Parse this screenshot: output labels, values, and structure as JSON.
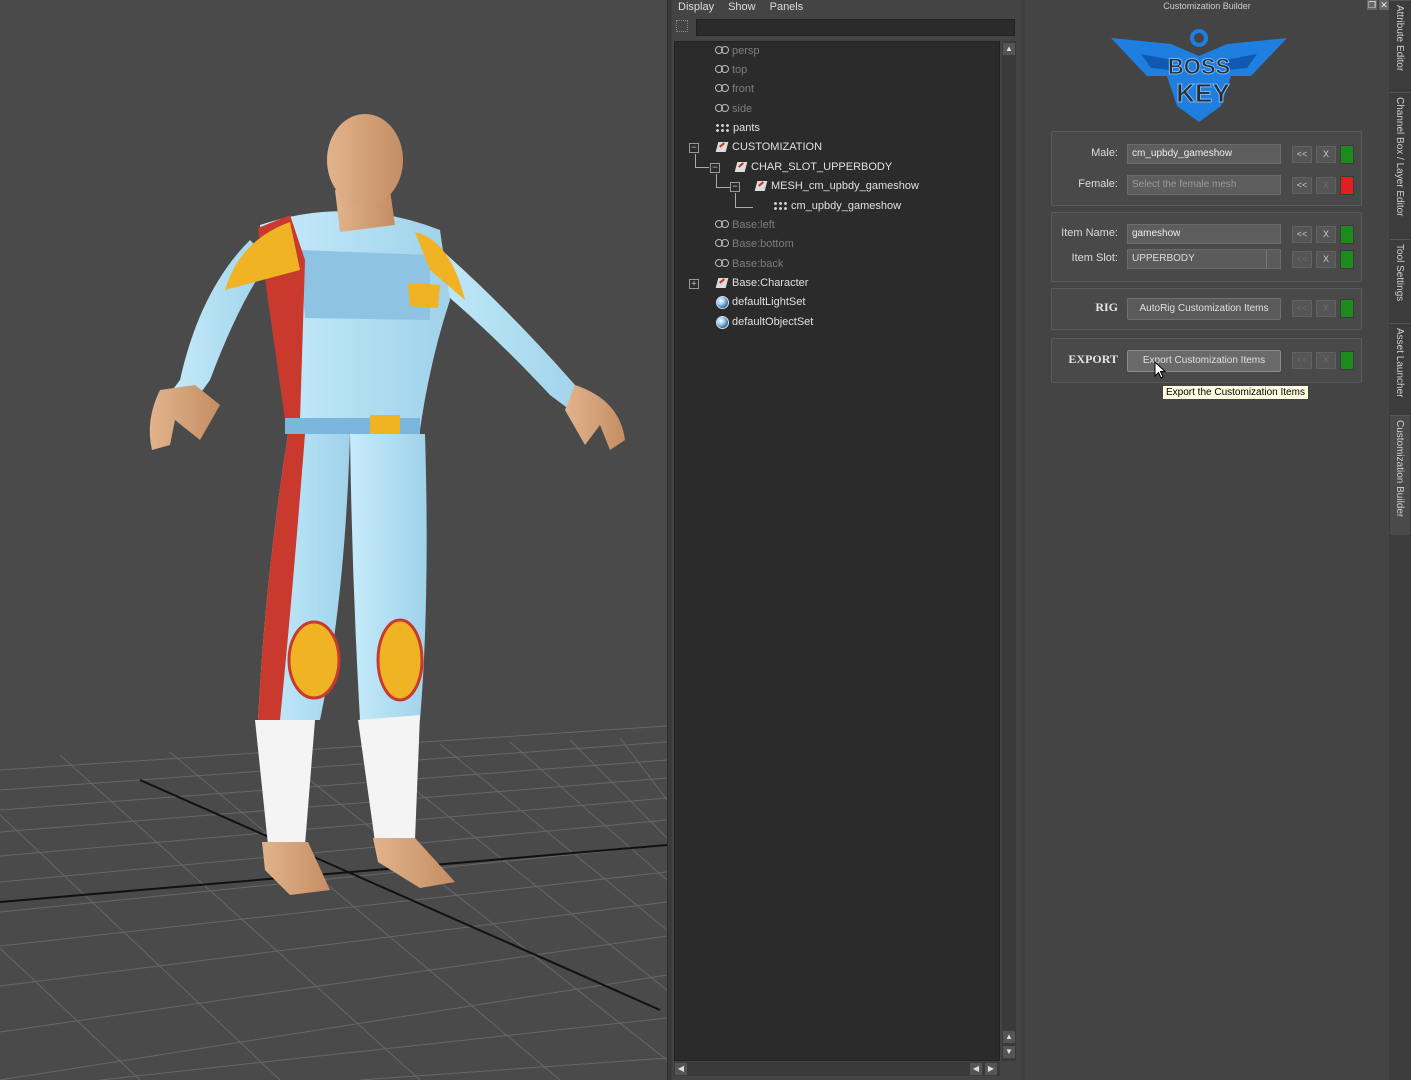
{
  "outliner": {
    "menus": [
      "Display",
      "Show",
      "Panels"
    ],
    "filter_value": "",
    "rows": [
      {
        "label": "persp",
        "icon": "camera-icon"
      },
      {
        "label": "top",
        "icon": "camera-icon"
      },
      {
        "label": "front",
        "icon": "camera-icon"
      },
      {
        "label": "side",
        "icon": "camera-icon"
      },
      {
        "label": "pants",
        "icon": "mesh-icon"
      },
      {
        "label": "CUSTOMIZATION",
        "icon": "transform-icon"
      },
      {
        "label": "CHAR_SLOT_UPPERBODY",
        "icon": "transform-icon"
      },
      {
        "label": "MESH_cm_upbdy_gameshow",
        "icon": "transform-icon"
      },
      {
        "label": "cm_upbdy_gameshow",
        "icon": "mesh-icon"
      },
      {
        "label": "Base:left",
        "icon": "camera-icon"
      },
      {
        "label": "Base:bottom",
        "icon": "camera-icon"
      },
      {
        "label": "Base:back",
        "icon": "camera-icon"
      },
      {
        "label": "Base:Character",
        "icon": "transform-icon"
      },
      {
        "label": "defaultLightSet",
        "icon": "set-icon"
      },
      {
        "label": "defaultObjectSet",
        "icon": "set-icon"
      }
    ]
  },
  "builder": {
    "title": "Customization Builder",
    "window_controls": [
      "restore-icon",
      "close-icon"
    ],
    "logo_text": [
      "BOSS",
      "KEY"
    ],
    "male": {
      "label": "Male:",
      "value": "cm_upbdy_gameshow",
      "back": "<<",
      "clear": "X",
      "status_color": "#1e8a1e"
    },
    "female": {
      "label": "Female:",
      "placeholder": "Select the female mesh",
      "back": "<<",
      "clear": "X",
      "status_color": "#e02020"
    },
    "item_name": {
      "label": "Item Name:",
      "value": "gameshow",
      "back": "<<",
      "clear": "X",
      "status_color": "#1e8a1e"
    },
    "item_slot": {
      "label": "Item Slot:",
      "value": "UPPERBODY",
      "back": "<<",
      "clear": "X",
      "status_color": "#1e8a1e"
    },
    "rig": {
      "label": "RIG",
      "button": "AutoRig Customization Items",
      "back": "<<",
      "clear": "X",
      "status_color": "#1e8a1e"
    },
    "export": {
      "label": "EXPORT",
      "button": "Export Customization Items",
      "back": "<<",
      "clear": "X",
      "status_color": "#1e8a1e"
    },
    "tooltip": "Export the Customization Items"
  },
  "side_tabs": [
    "Attribute Editor",
    "Channel Box / Layer Editor",
    "Tool Settings",
    "Asset Launcher",
    "Customization Builder"
  ],
  "colors": {
    "accent_blue": "#1f7fe0",
    "status_green": "#1e8a1e",
    "status_red": "#e02020"
  }
}
